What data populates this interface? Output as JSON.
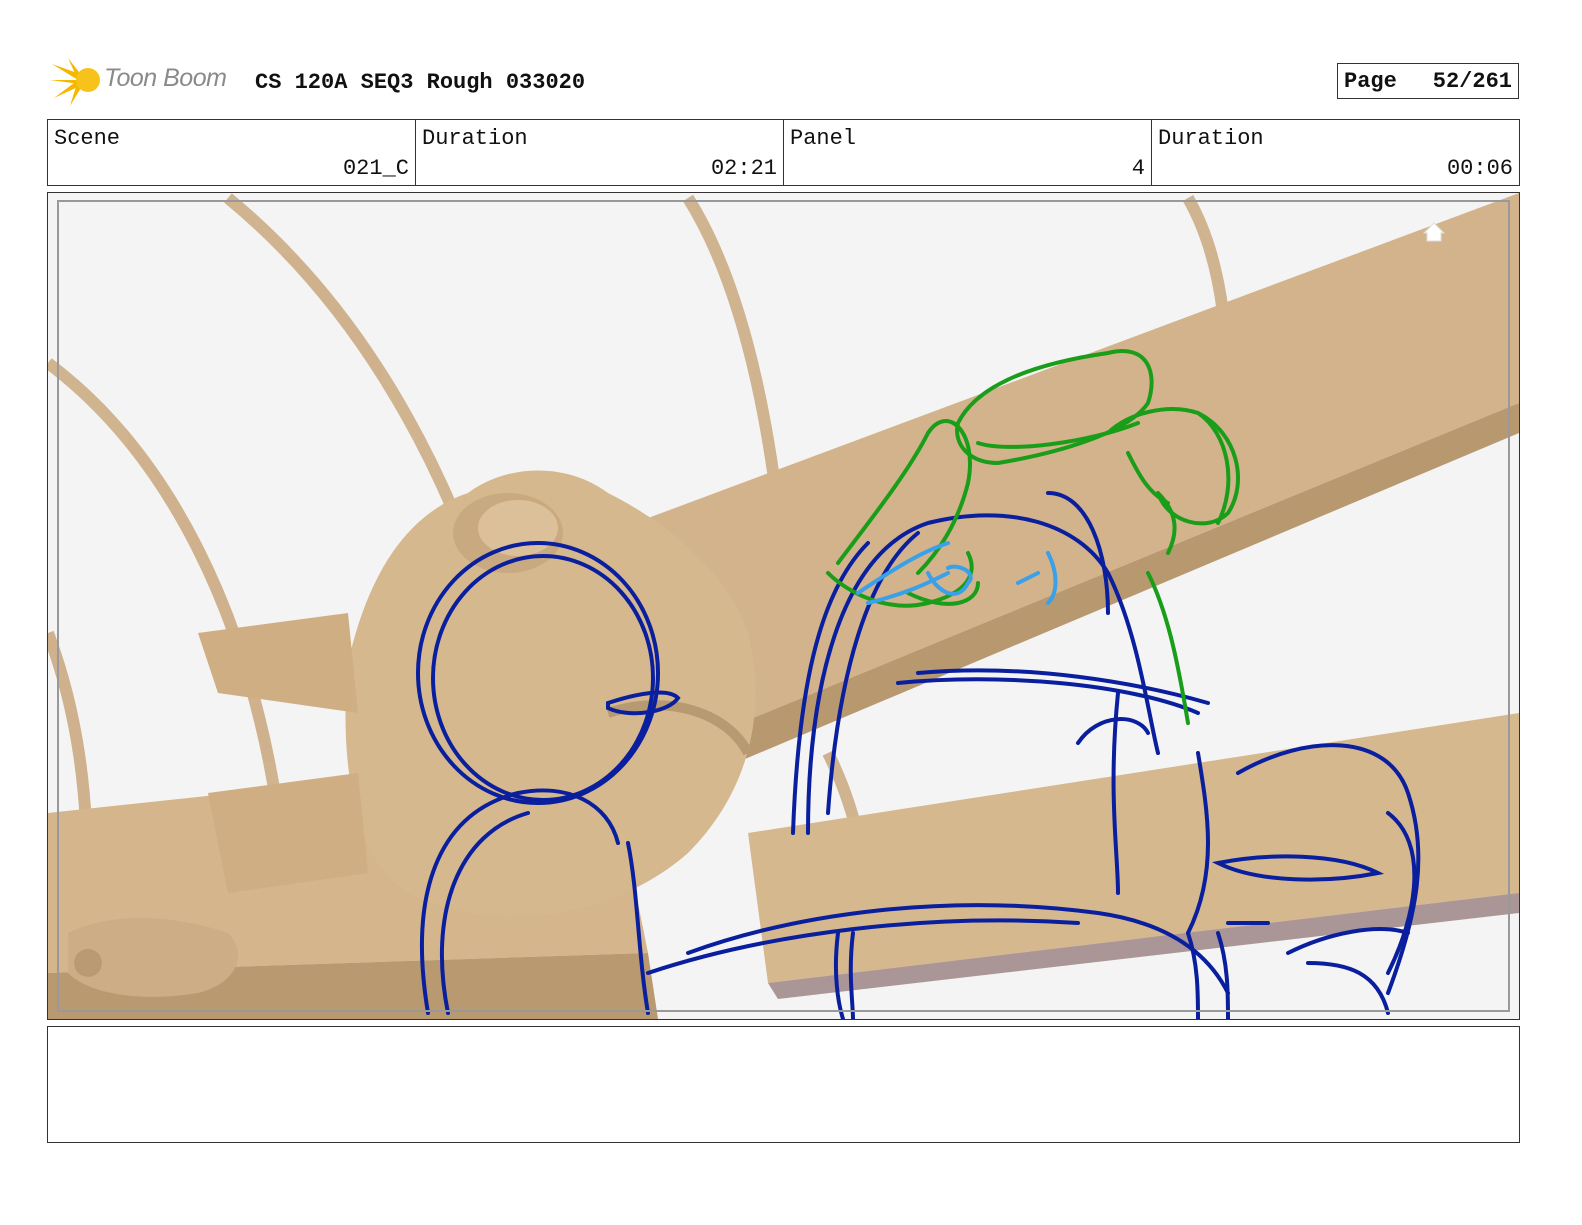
{
  "header": {
    "logo_text": "Toon Boom",
    "title": "CS 120A SEQ3 Rough 033020",
    "page_label": "Page",
    "page_value": "52/261"
  },
  "info": {
    "scene_label": "Scene",
    "scene_value": "021_C",
    "duration_label": "Duration",
    "duration_value": "02:21",
    "panel_label": "Panel",
    "panel_value": "4",
    "panel_duration_label": "Duration",
    "panel_duration_value": "00:06"
  },
  "panel_image": {
    "description_icons": [
      "home-icon"
    ],
    "colors": {
      "statue": "#d6b88f",
      "statue_shade": "#b89a72",
      "sketch_blue": "#0a1f9e",
      "sketch_green": "#1a9e1a",
      "sketch_light_blue": "#3aa0e8",
      "background": "#f4f4f4"
    }
  },
  "notes": {
    "text": ""
  }
}
